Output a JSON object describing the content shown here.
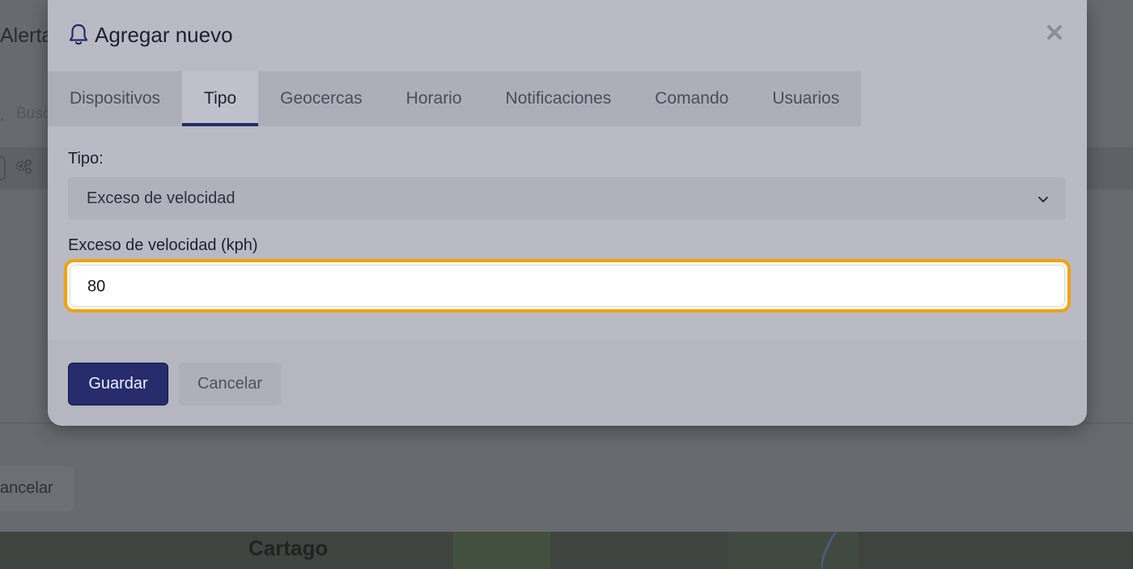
{
  "background": {
    "page_title": "Alerta",
    "search_placeholder": "Busc",
    "cancel_label": "ancelar",
    "map_label": "Cartago"
  },
  "modal": {
    "title": "Agregar nuevo",
    "icon": "bell-icon",
    "tabs": [
      {
        "label": "Dispositivos",
        "active": false
      },
      {
        "label": "Tipo",
        "active": true
      },
      {
        "label": "Geocercas",
        "active": false
      },
      {
        "label": "Horario",
        "active": false
      },
      {
        "label": "Notificaciones",
        "active": false
      },
      {
        "label": "Comando",
        "active": false
      },
      {
        "label": "Usuarios",
        "active": false
      }
    ],
    "type_field": {
      "label": "Tipo:",
      "value": "Exceso de velocidad"
    },
    "speed_field": {
      "label": "Exceso de velocidad (kph)",
      "value": "80"
    },
    "buttons": {
      "save": "Guardar",
      "cancel": "Cancelar"
    }
  },
  "colors": {
    "accent": "#262c6c",
    "focus_ring": "#f0a20f"
  }
}
